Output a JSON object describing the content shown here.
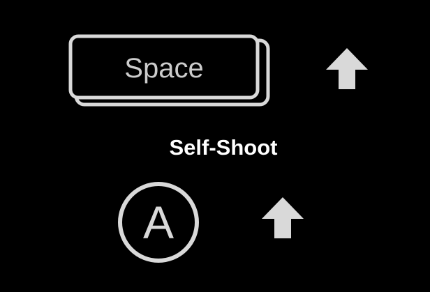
{
  "prompt": {
    "key_label": "Space",
    "action": "Self-Shoot",
    "gamepad_button": "A",
    "key_icon": "spacebar-key-icon",
    "arrow_icon": "arrow-up-icon",
    "button_icon": "gamepad-a-button-icon"
  },
  "colors": {
    "background": "#000000",
    "icon": "#d9d9d9",
    "key_text": "#cccccc",
    "action_text": "#ffffff"
  }
}
